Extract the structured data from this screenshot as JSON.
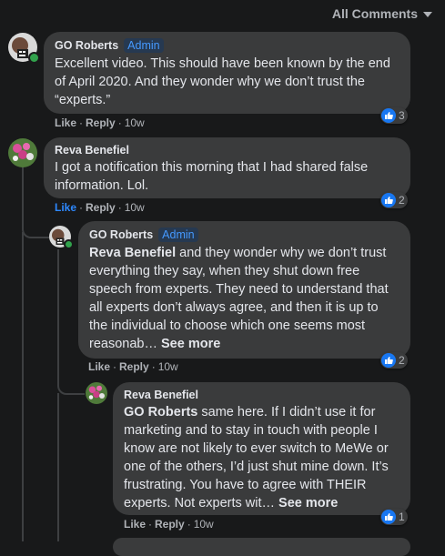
{
  "header": {
    "label": "All Comments"
  },
  "comments": [
    {
      "author": "GO Roberts",
      "badge": "Admin",
      "text": "Excellent video. This should have been known by the end of April 2020. And they wonder why we don’t trust the “experts.”",
      "actions": {
        "like": "Like",
        "reply": "Reply",
        "time": "10w"
      },
      "reaction_count": "3"
    },
    {
      "author": "Reva Benefiel",
      "text": "I got a notification this morning that I had shared false information. Lol.",
      "actions": {
        "like": "Like",
        "reply": "Reply",
        "time": "10w"
      },
      "reaction_count": "2"
    },
    {
      "author": "GO Roberts",
      "badge": "Admin",
      "mention": "Reva Benefiel",
      "text": " and they wonder why we don’t trust everything they say, when they shut down free speech from experts. They need to understand that all experts don’t always agree, and then it is up to the individual to choose which one seems most reasonab… ",
      "see_more": "See more",
      "actions": {
        "like": "Like",
        "reply": "Reply",
        "time": "10w"
      },
      "reaction_count": "2"
    },
    {
      "author": "Reva Benefiel",
      "mention": "GO Roberts",
      "text": " same here. If I didn’t use it for marketing and to stay in touch with people I know are not likely to ever switch to MeWe or one of the others, I’d just shut mine down. It’s frustrating. You have to agree with THEIR experts. Not experts wit… ",
      "see_more": "See more",
      "actions": {
        "like": "Like",
        "reply": "Reply",
        "time": "10w"
      },
      "reaction_count": "1"
    }
  ],
  "colors": {
    "background": "#18191a",
    "bubble": "#3a3b3c",
    "accent": "#2d88ff",
    "online": "#31a24c"
  },
  "icons": [
    "chevron-down-icon",
    "like-reaction-icon",
    "online-status-icon"
  ]
}
